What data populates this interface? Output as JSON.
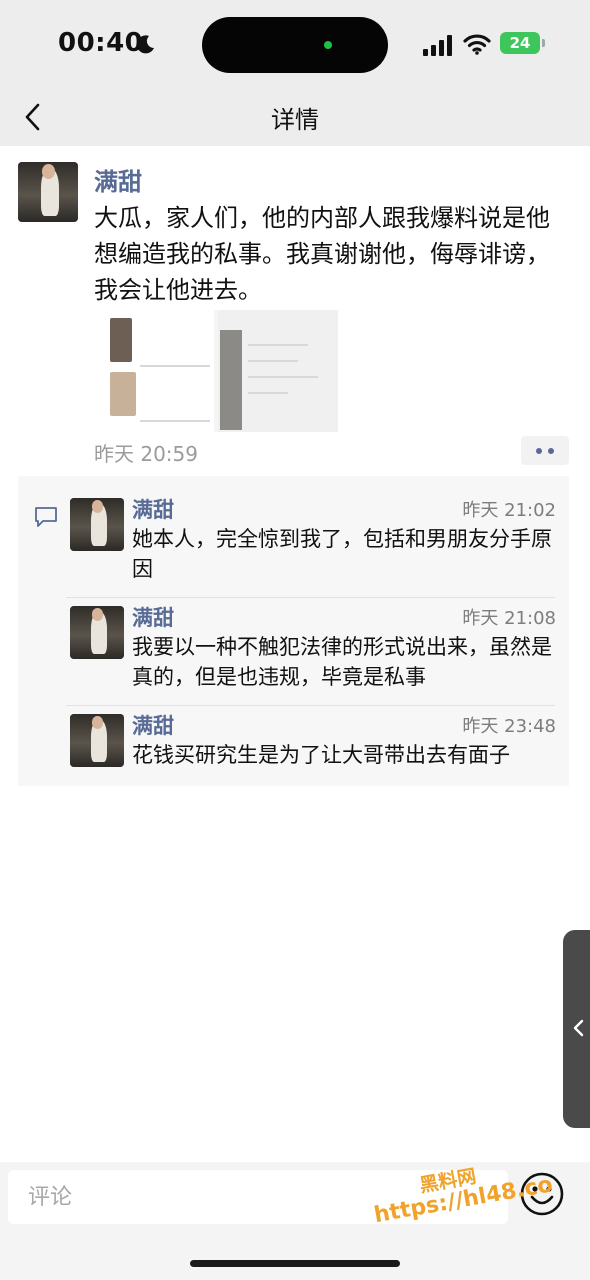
{
  "status_bar": {
    "time": "00:40",
    "battery": "24"
  },
  "navbar": {
    "title": "详情"
  },
  "post": {
    "author": "满甜",
    "text": "大瓜，家人们，他的内部人跟我爆料说是他想编造我的私事。我真谢谢他，侮辱诽谤，我会让他进去。",
    "time": "昨天 20:59"
  },
  "comments": [
    {
      "author": "满甜",
      "time": "昨天 21:02",
      "text": "她本人，完全惊到我了，包括和男朋友分手原因"
    },
    {
      "author": "满甜",
      "time": "昨天 21:08",
      "text": "我要以一种不触犯法律的形式说出来，虽然是真的，但是也违规，毕竟是私事"
    },
    {
      "author": "满甜",
      "time": "昨天 23:48",
      "text": "花钱买研究生是为了让大哥带出去有面子"
    }
  ],
  "comment_box": {
    "placeholder": "评论"
  },
  "watermark": {
    "line1": "黑料网",
    "line2": "https://hl48.co"
  },
  "colors": {
    "name_link": "#576b95",
    "bar_background": "#ededed",
    "watermark": "#f0a22a"
  }
}
